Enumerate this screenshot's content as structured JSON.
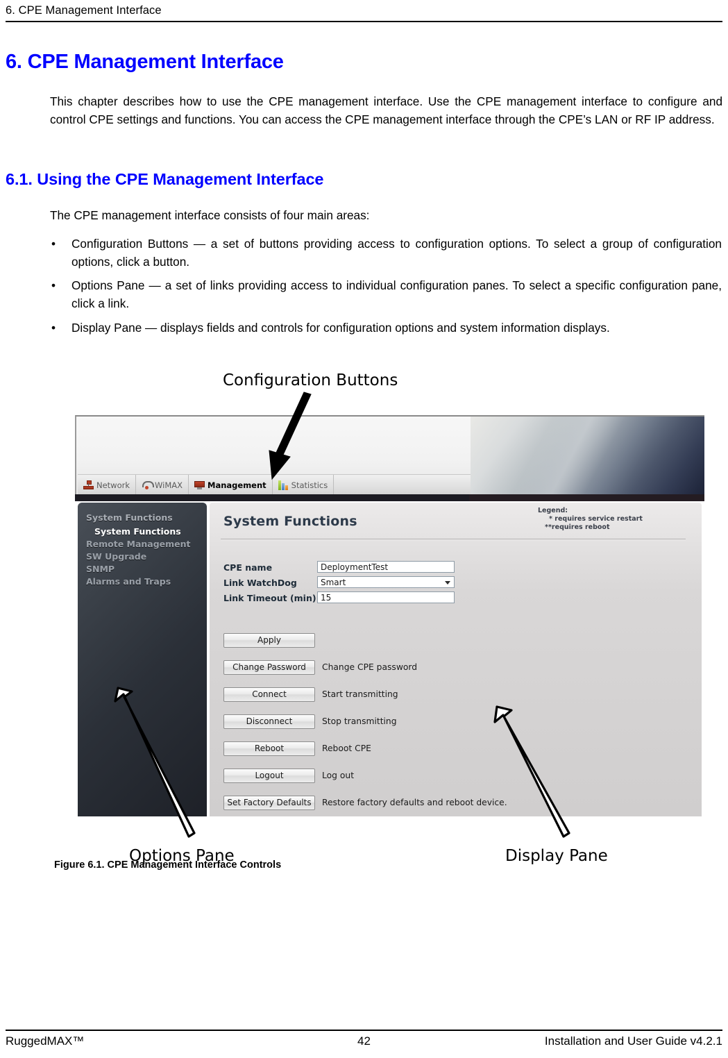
{
  "page": {
    "running_head": "6. CPE Management Interface",
    "chapter_title": "6. CPE Management Interface",
    "intro_paragraph": "This chapter describes how to use the CPE management interface. Use the CPE management interface to configure and control CPE settings and functions. You can access the CPE management interface through the CPE’s LAN or RF IP address.",
    "section_title": "6.1. Using the CPE Management Interface",
    "section_lead": "The CPE management interface consists of four main areas:",
    "bullet_mark": "•",
    "bullets": [
      "Configuration Buttons — a set of buttons providing access to configuration options. To select a group of configuration options, click a button.",
      "Options Pane — a set of links providing access to individual configuration panes. To select a specific configuration pane, click a link.",
      "Display Pane — displays fields and controls for configuration options and system information displays."
    ],
    "figure_caption": "Figure 6.1. CPE Management Interface Controls"
  },
  "callouts": {
    "configuration_buttons": "Configuration Buttons",
    "options_pane": "Options Pane",
    "display_pane": "Display Pane"
  },
  "screenshot": {
    "tabs": [
      {
        "label": "Network",
        "icon": "network-icon",
        "active": false
      },
      {
        "label": "WiMAX",
        "icon": "wimax-antenna-icon",
        "active": false
      },
      {
        "label": "Management",
        "icon": "monitor-icon",
        "active": true
      },
      {
        "label": "Statistics",
        "icon": "bar-chart-icon",
        "active": false
      }
    ],
    "options_pane": {
      "group_heading": "System Functions",
      "links": [
        {
          "label": "System Functions",
          "selected": true
        },
        {
          "label": "Remote Management",
          "selected": false
        },
        {
          "label": "SW Upgrade",
          "selected": false
        },
        {
          "label": "SNMP",
          "selected": false
        },
        {
          "label": "Alarms and Traps",
          "selected": false
        }
      ]
    },
    "display_pane": {
      "title": "System Functions",
      "legend": {
        "title": "Legend:",
        "line1": "*  requires service restart",
        "line2": "**requires reboot"
      },
      "fields": [
        {
          "label": "CPE name",
          "value": "DeploymentTest",
          "type": "text"
        },
        {
          "label": "Link WatchDog",
          "value": "Smart",
          "type": "select"
        },
        {
          "label": "Link Timeout (min)",
          "value": "15",
          "type": "text"
        }
      ],
      "actions": [
        {
          "button": "Apply",
          "description": ""
        },
        {
          "button": "Change Password",
          "description": "Change CPE password"
        },
        {
          "button": "Connect",
          "description": "Start transmitting"
        },
        {
          "button": "Disconnect",
          "description": "Stop transmitting"
        },
        {
          "button": "Reboot",
          "description": "Reboot CPE"
        },
        {
          "button": "Logout",
          "description": "Log out"
        },
        {
          "button": "Set Factory Defaults",
          "description": "Restore factory defaults and reboot device."
        }
      ]
    }
  },
  "footer": {
    "left": "RuggedMAX™",
    "page_number": "42",
    "right": "Installation and User Guide v4.2.1"
  },
  "colors": {
    "heading_blue": "#0000ff",
    "sidebar_dark": "#2b3038",
    "accent_red": "#b33b22"
  }
}
